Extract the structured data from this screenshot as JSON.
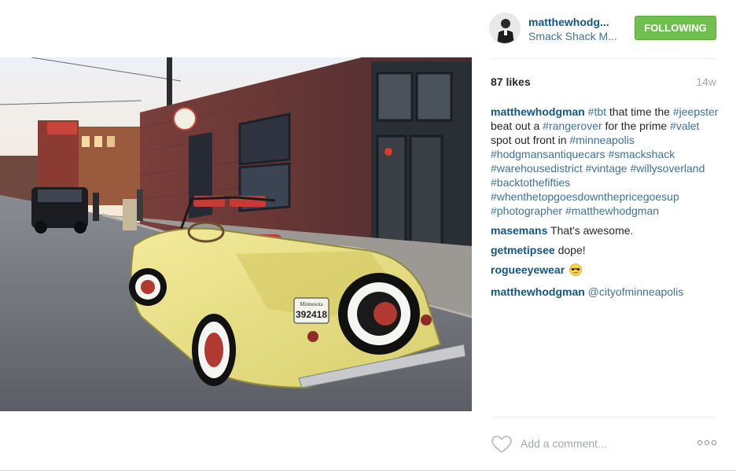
{
  "header": {
    "username": "matthewhodg...",
    "location": "Smack Shack M...",
    "follow_label": "FOLLOWING"
  },
  "stats": {
    "likes": "87 likes",
    "time": "14w"
  },
  "caption": {
    "user": "matthewhodgman",
    "segments": [
      {
        "text": "#tbt",
        "tag": true
      },
      {
        "text": " that time the ",
        "tag": false
      },
      {
        "text": "#jeepster",
        "tag": true
      },
      {
        "text": " beat out a ",
        "tag": false
      },
      {
        "text": "#rangerover",
        "tag": true
      },
      {
        "text": " for the prime ",
        "tag": false
      },
      {
        "text": "#valet",
        "tag": true
      },
      {
        "text": " spot out front in ",
        "tag": false
      },
      {
        "text": "#minneapolis",
        "tag": true
      },
      {
        "text": " ",
        "tag": false
      },
      {
        "text": "#hodgmansantiquecars",
        "tag": true
      },
      {
        "text": " ",
        "tag": false
      },
      {
        "text": "#smackshack",
        "tag": true
      },
      {
        "text": " ",
        "tag": false
      },
      {
        "text": "#warehousedistrict",
        "tag": true
      },
      {
        "text": " ",
        "tag": false
      },
      {
        "text": "#vintage",
        "tag": true
      },
      {
        "text": " ",
        "tag": false
      },
      {
        "text": "#willysoverland",
        "tag": true
      },
      {
        "text": " ",
        "tag": false
      },
      {
        "text": "#backtothefifties",
        "tag": true
      },
      {
        "text": " ",
        "tag": false
      },
      {
        "text": "#whenthetopgoesdownthepricegoesup",
        "tag": true
      },
      {
        "text": " ",
        "tag": false
      },
      {
        "text": "#photographer",
        "tag": true
      },
      {
        "text": " ",
        "tag": false
      },
      {
        "text": "#matthewhodgman",
        "tag": true
      }
    ]
  },
  "comments": [
    {
      "user": "masemans",
      "text": "That's awesome."
    },
    {
      "user": "getmetipsee",
      "text": "dope!"
    },
    {
      "user": "rogueeyewear",
      "text": "",
      "emoji": "sunglasses-emoji"
    },
    {
      "user": "matthewhodgman",
      "text": "@cityofminneapolis",
      "text_is_mention": true
    }
  ],
  "footer": {
    "comment_placeholder": "Add a comment...",
    "heart_icon": "heart-outline-icon",
    "more_icon": "more-options-icon"
  },
  "photo": {
    "plate_number": "392418",
    "plate_state": "Minnesota"
  },
  "colors": {
    "link": "#125688",
    "hashtag": "#3f729b",
    "follow_button": "#70c050",
    "muted": "#a5a7aa"
  }
}
